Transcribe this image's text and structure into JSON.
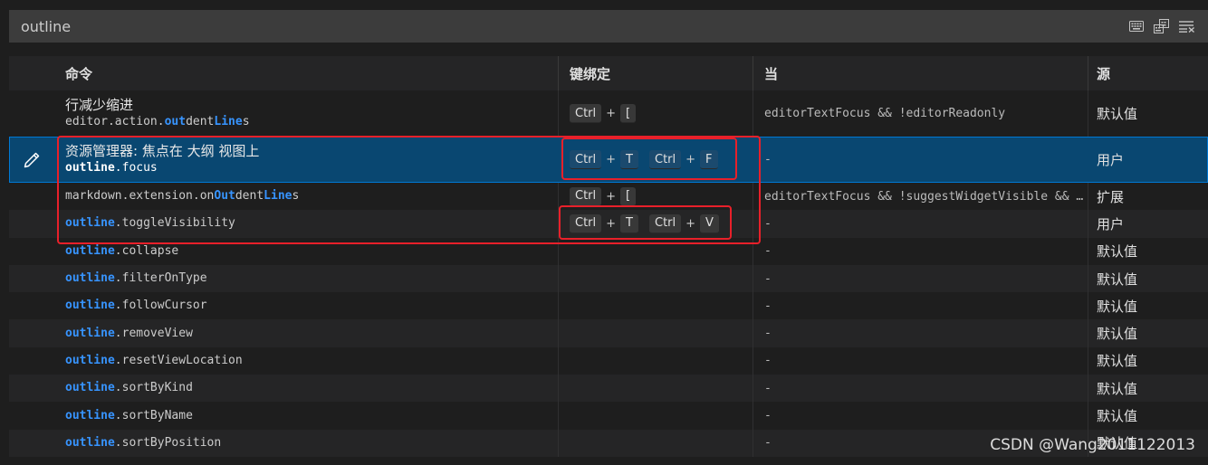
{
  "search": {
    "value": "outline",
    "placeholder": ""
  },
  "search_actions": [
    "keyboard-icon",
    "record-keys-icon",
    "sort-by-precedence-icon"
  ],
  "header": {
    "command": "命令",
    "keybinding": "键绑定",
    "when": "当",
    "source": "源"
  },
  "rows": [
    {
      "title": "行减少缩进",
      "id_parts": [
        [
          "editor.action.",
          false
        ],
        [
          "out",
          true
        ],
        [
          "dent",
          false
        ],
        [
          "Line",
          true
        ],
        [
          "s",
          false
        ]
      ],
      "keys": [
        [
          "Ctrl",
          "["
        ]
      ],
      "when": "editorTextFocus && !editorReadonly",
      "source": "默认值"
    },
    {
      "title": "资源管理器: 焦点在 大纲 视图上",
      "id_parts": [
        [
          "outline",
          true
        ],
        [
          ".focus",
          false
        ]
      ],
      "keys": [
        [
          "Ctrl",
          "T"
        ],
        [
          "Ctrl",
          "F"
        ]
      ],
      "when": "-",
      "source": "用户",
      "selected": true
    },
    {
      "title": "",
      "id_parts": [
        [
          "markdown.extension.on",
          false
        ],
        [
          "Out",
          true
        ],
        [
          "dent",
          false
        ],
        [
          "Line",
          true
        ],
        [
          "s",
          false
        ]
      ],
      "keys": [
        [
          "Ctrl",
          "["
        ]
      ],
      "when": "editorTextFocus && !suggestWidgetVisible && editorLangId == 'markdown'",
      "source": "扩展"
    },
    {
      "title": "",
      "id_parts": [
        [
          "outline",
          true
        ],
        [
          ".toggleVisibility",
          false
        ]
      ],
      "keys": [
        [
          "Ctrl",
          "T"
        ],
        [
          "Ctrl",
          "V"
        ]
      ],
      "when": "-",
      "source": "用户"
    },
    {
      "title": "",
      "id_parts": [
        [
          "outline",
          true
        ],
        [
          ".collapse",
          false
        ]
      ],
      "keys": [],
      "when": "-",
      "source": "默认值"
    },
    {
      "title": "",
      "id_parts": [
        [
          "outline",
          true
        ],
        [
          ".filterOnType",
          false
        ]
      ],
      "keys": [],
      "when": "-",
      "source": "默认值"
    },
    {
      "title": "",
      "id_parts": [
        [
          "outline",
          true
        ],
        [
          ".followCursor",
          false
        ]
      ],
      "keys": [],
      "when": "-",
      "source": "默认值"
    },
    {
      "title": "",
      "id_parts": [
        [
          "outline",
          true
        ],
        [
          ".removeView",
          false
        ]
      ],
      "keys": [],
      "when": "-",
      "source": "默认值"
    },
    {
      "title": "",
      "id_parts": [
        [
          "outline",
          true
        ],
        [
          ".resetViewLocation",
          false
        ]
      ],
      "keys": [],
      "when": "-",
      "source": "默认值"
    },
    {
      "title": "",
      "id_parts": [
        [
          "outline",
          true
        ],
        [
          ".sortByKind",
          false
        ]
      ],
      "keys": [],
      "when": "-",
      "source": "默认值"
    },
    {
      "title": "",
      "id_parts": [
        [
          "outline",
          true
        ],
        [
          ".sortByName",
          false
        ]
      ],
      "keys": [],
      "when": "-",
      "source": "默认值"
    },
    {
      "title": "",
      "id_parts": [
        [
          "outline",
          true
        ],
        [
          ".sortByPosition",
          false
        ]
      ],
      "keys": [],
      "when": "-",
      "source": "默认值"
    }
  ],
  "watermark": "CSDN @Wang2011122013",
  "colors": {
    "accent": "#3794ff",
    "selection": "#094771",
    "annotation": "#e8202a"
  }
}
